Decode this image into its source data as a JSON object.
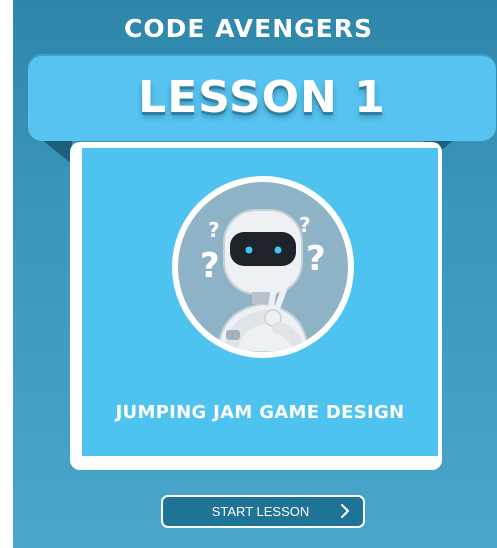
{
  "header": {
    "brand": "CODE AVENGERS"
  },
  "ribbon": {
    "title": "LESSON 1"
  },
  "lesson": {
    "name": "JUMPING JAM GAME DESIGN",
    "image_icon": "confused-robot-icon"
  },
  "actions": {
    "start_label": "START LESSON",
    "start_icon": "chevron-right-icon"
  },
  "colors": {
    "panel": "#3a95ba",
    "ribbon": "#56c3f0",
    "card_inner": "#4fc3f0",
    "button": "#1f7397",
    "text": "#ffffff"
  }
}
